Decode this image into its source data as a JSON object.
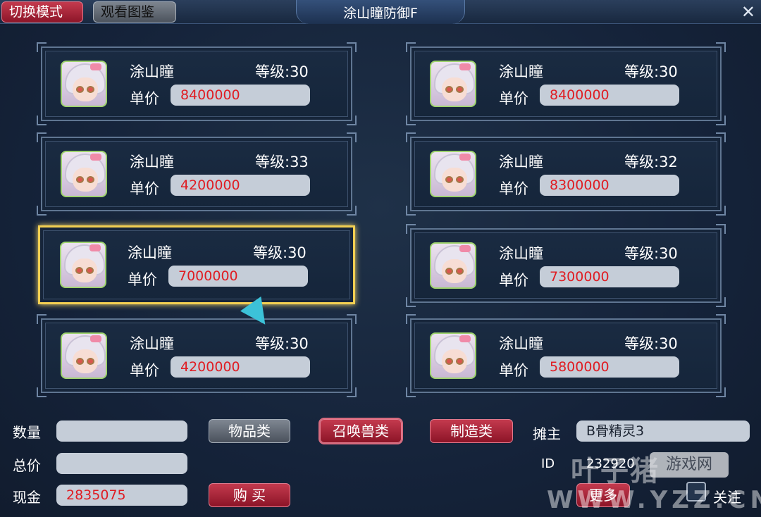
{
  "header": {
    "switch_mode": "切换模式",
    "view_catalog": "观看图鉴",
    "title": "涂山瞳防御F",
    "close": "✕"
  },
  "labels": {
    "price": "单价"
  },
  "listings": [
    {
      "name": "涂山瞳",
      "level": "等级:30",
      "price": "8400000"
    },
    {
      "name": "涂山瞳",
      "level": "等级:30",
      "price": "8400000"
    },
    {
      "name": "涂山瞳",
      "level": "等级:33",
      "price": "4200000"
    },
    {
      "name": "涂山瞳",
      "level": "等级:32",
      "price": "8300000"
    },
    {
      "name": "涂山瞳",
      "level": "等级:30",
      "price": "7000000"
    },
    {
      "name": "涂山瞳",
      "level": "等级:30",
      "price": "7300000"
    },
    {
      "name": "涂山瞳",
      "level": "等级:30",
      "price": "4200000"
    },
    {
      "name": "涂山瞳",
      "level": "等级:30",
      "price": "5800000"
    }
  ],
  "selected_listing": 5,
  "purchase": {
    "quantity_label": "数量",
    "quantity_value": "",
    "total_label": "总价",
    "total_value": "",
    "cash_label": "现金",
    "cash_value": "2835075",
    "buy_button": "购 买"
  },
  "categories": {
    "items": "物品类",
    "summon_beasts": "召唤兽类",
    "crafting": "制造类"
  },
  "seller": {
    "owner_label": "摊主",
    "owner_value": "B骨精灵3",
    "id_label": "ID",
    "id_value": "232920",
    "more_button": "更多",
    "follow_label": "关注"
  },
  "watermark": {
    "logo": "叶子猪",
    "site": "游戏网",
    "url": "WWW.YZZ.CN"
  }
}
